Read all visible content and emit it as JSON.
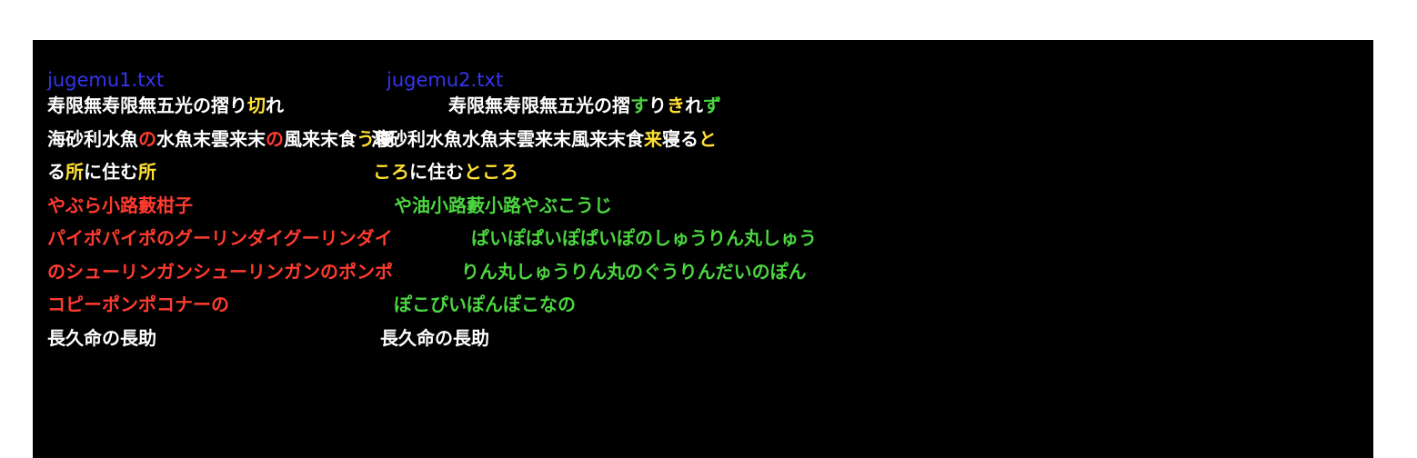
{
  "colors": {
    "background": "#000000",
    "title": "#3535f0",
    "equal": "#ffffff",
    "deleted": "#ff3b2f",
    "inserted": "#4cd640",
    "changed": "#ffe033"
  },
  "files": {
    "left": "jugemu1.txt",
    "right": "jugemu2.txt"
  },
  "rows": [
    {
      "left": [
        {
          "t": "寿限無寿限無五光の摺り",
          "c": "equal"
        },
        {
          "t": "切",
          "c": "changed"
        },
        {
          "t": "れ",
          "c": "equal"
        }
      ],
      "right": [
        {
          "t": "寿限無寿限無五光の摺",
          "c": "equal"
        },
        {
          "t": "す",
          "c": "inserted"
        },
        {
          "t": "り",
          "c": "equal"
        },
        {
          "t": "き",
          "c": "changed"
        },
        {
          "t": "れ",
          "c": "equal"
        },
        {
          "t": "ず",
          "c": "inserted"
        }
      ]
    },
    {
      "left": [
        {
          "t": "海砂利水魚",
          "c": "equal"
        },
        {
          "t": "の",
          "c": "deleted"
        },
        {
          "t": "水魚末雲来末",
          "c": "equal"
        },
        {
          "t": "の",
          "c": "deleted"
        },
        {
          "t": "風来末食",
          "c": "equal"
        },
        {
          "t": "う",
          "c": "changed"
        },
        {
          "t": "寝",
          "c": "equal"
        }
      ],
      "right": [
        {
          "t": "海砂利水魚水魚末雲来末風来末食",
          "c": "equal"
        },
        {
          "t": "来",
          "c": "changed"
        },
        {
          "t": "寝る",
          "c": "equal"
        },
        {
          "t": "と",
          "c": "changed"
        }
      ]
    },
    {
      "left": [
        {
          "t": "る",
          "c": "equal"
        },
        {
          "t": "所",
          "c": "changed"
        },
        {
          "t": "に住む",
          "c": "equal"
        },
        {
          "t": "所",
          "c": "changed"
        }
      ],
      "right": [
        {
          "t": "ころ",
          "c": "changed"
        },
        {
          "t": "に住む",
          "c": "equal"
        },
        {
          "t": "ところ",
          "c": "changed"
        }
      ]
    },
    {
      "left": [
        {
          "t": "やぶら小路藪柑子",
          "c": "deleted"
        }
      ],
      "right": [
        {
          "t": "や油小路藪小路やぶこうじ",
          "c": "inserted"
        }
      ]
    },
    {
      "left": [
        {
          "t": "パイポパイポのグーリンダイグーリンダイ",
          "c": "deleted"
        }
      ],
      "right": [
        {
          "t": "ぱいぽぱいぽぱいぽのしゅうりん丸しゅう",
          "c": "inserted"
        }
      ]
    },
    {
      "left": [
        {
          "t": "のシューリンガンシューリンガンのポンポ",
          "c": "deleted"
        }
      ],
      "right": [
        {
          "t": "りん丸しゅうりん丸のぐうりんだいのぽん",
          "c": "inserted"
        }
      ]
    },
    {
      "left": [
        {
          "t": "コピーポンポコナーの",
          "c": "deleted"
        }
      ],
      "right": [
        {
          "t": "ぽこぴいぽんぽこなの",
          "c": "inserted"
        }
      ]
    },
    {
      "left": [
        {
          "t": "長久命の長助",
          "c": "equal"
        }
      ],
      "right": [
        {
          "t": "長久命の長助",
          "c": "equal"
        }
      ]
    }
  ]
}
